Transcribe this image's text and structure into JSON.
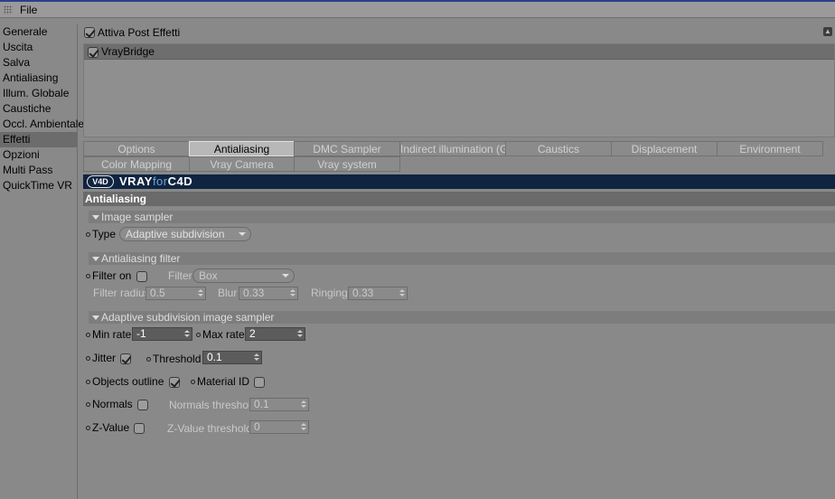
{
  "menu": {
    "file": "File"
  },
  "sidebar": {
    "items": [
      {
        "label": "Generale"
      },
      {
        "label": "Uscita"
      },
      {
        "label": "Salva"
      },
      {
        "label": "Antialiasing"
      },
      {
        "label": "Illum. Globale"
      },
      {
        "label": "Caustiche"
      },
      {
        "label": "Occl. Ambientale"
      },
      {
        "label": "Effetti",
        "active": true
      },
      {
        "label": "Opzioni"
      },
      {
        "label": "Multi Pass"
      },
      {
        "label": "QuickTime VR"
      }
    ]
  },
  "post_effects": {
    "label": "Attiva Post Effetti",
    "checked": true
  },
  "effects": [
    {
      "label": "VrayBridge",
      "checked": true
    }
  ],
  "tabs": {
    "row1": [
      "Options",
      "Antialiasing",
      "DMC Sampler",
      "Indirect illumination (GI)",
      "Caustics",
      "Displacement",
      "Environment"
    ],
    "row2": [
      "Color Mapping",
      "Vray Camera",
      "Vray system"
    ],
    "active": "Antialiasing"
  },
  "banner": {
    "mark": "V4D",
    "brand": "VRAY",
    "for": "for",
    "product": "C4D"
  },
  "section_title": "Antialiasing",
  "image_sampler": {
    "heading": "Image sampler",
    "type_label": "Type",
    "type_value": "Adaptive subdivision"
  },
  "aa_filter": {
    "heading": "Antialiasing filter",
    "filter_on_label": "Filter on",
    "filter_label": "Filter",
    "filter_value": "Box",
    "radius_label": "Filter radius",
    "radius_value": "0.5",
    "blur_label": "Blur",
    "blur_value": "0.33",
    "ringing_label": "Ringing",
    "ringing_value": "0.33"
  },
  "adaptive": {
    "heading": "Adaptive subdivision image sampler",
    "min_rate_label": "Min rate",
    "min_rate_value": "-1",
    "max_rate_label": "Max rate",
    "max_rate_value": "2",
    "jitter_label": "Jitter",
    "threshold_label": "Threshold",
    "threshold_value": "0.1",
    "objects_outline_label": "Objects outline",
    "material_id_label": "Material ID",
    "normals_label": "Normals",
    "normals_threshold_label": "Normals threshold",
    "normals_threshold_value": "0.1",
    "zvalue_label": "Z-Value",
    "zvalue_threshold_label": "Z-Value threshold",
    "zvalue_threshold_value": "0"
  }
}
